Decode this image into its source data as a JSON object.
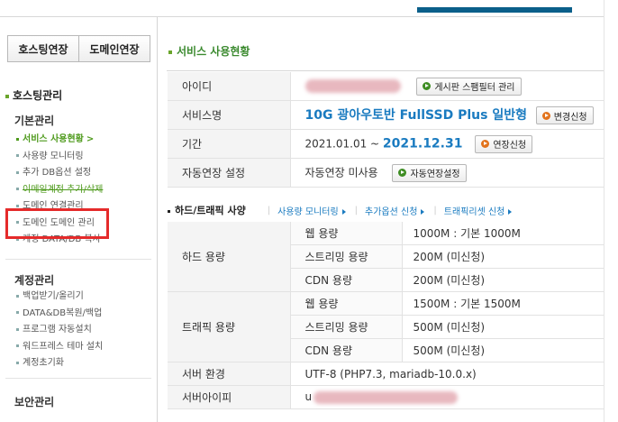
{
  "sidebar": {
    "tabs": [
      "호스팅연장",
      "도메인연장"
    ],
    "section_title": "호스팅관리",
    "groups": [
      {
        "title": "기본관리"
      },
      {
        "title": "계정관리"
      },
      {
        "title": "보안관리"
      }
    ],
    "basic_items": [
      "서비스 사용현황",
      "사용량 모니터링",
      "추가 DB옵션 설정",
      "이메일계정 추가/삭제",
      "도메인 연결관리",
      "도메인 도메인 관리",
      "계정 DATA/DB 복사"
    ],
    "active_chevron": ">",
    "account_items": [
      "백업받기/올리기",
      "DATA&DB복원/백업",
      "프로그램 자동설치",
      "워드프레스 테마 설치",
      "계정초기화"
    ]
  },
  "main": {
    "title": "서비스 사용현황",
    "info": {
      "id_label": "아이디",
      "id_button": "게시판 스팸필터 관리",
      "service_label": "서비스명",
      "service_name": "10G 광아우토반 FullSSD Plus 일반형",
      "service_button": "변경신청",
      "period_label": "기간",
      "period_start": "2021.01.01 ~",
      "period_end": "2021.12.31",
      "period_button": "연장신청",
      "auto_label": "자동연장 설정",
      "auto_value": "자동연장 미사용",
      "auto_button": "자동연장설정"
    },
    "spec": {
      "title": "하드/트래픽 사양",
      "links": [
        "사용량 모니터링",
        "추가옵션 신청",
        "트래픽리셋 신청"
      ],
      "hard_label": "하드 용량",
      "traffic_label": "트래픽 용량",
      "hard_rows": [
        {
          "name": "웹 용량",
          "value": "1000M : 기본 1000M"
        },
        {
          "name": "스트리밍 용량",
          "value": "200M (미신청)"
        },
        {
          "name": "CDN 용량",
          "value": "200M (미신청)"
        }
      ],
      "traffic_rows": [
        {
          "name": "웹 용량",
          "value": "1500M : 기본 1500M"
        },
        {
          "name": "스트리밍 용량",
          "value": "500M (미신청)"
        },
        {
          "name": "CDN 용량",
          "value": "500M (미신청)"
        }
      ],
      "server_env_label": "서버 환경",
      "server_env_value": "UTF-8 (PHP7.3, mariadb-10.0.x)",
      "server_ip_label": "서버아이피",
      "server_ip_prefix": "u"
    }
  }
}
